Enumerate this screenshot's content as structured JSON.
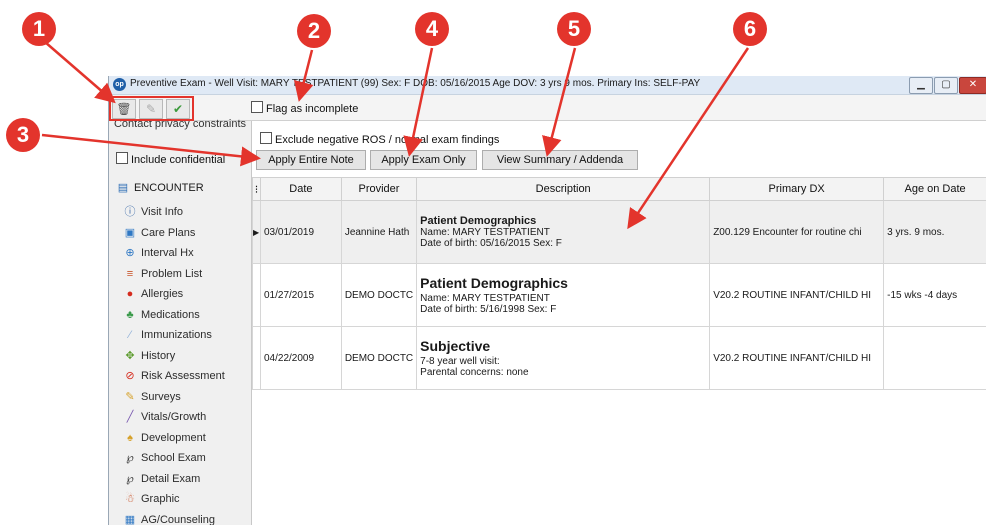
{
  "window": {
    "logo_text": "op",
    "title": "Preventive Exam - Well Visit: MARY TESTPATIENT (99)  Sex: F  DOB: 05/16/2015  Age DOV: 3 yrs 9 mos.  Primary Ins: SELF-PAY"
  },
  "toolbar": {
    "flag_label": "Flag as incomplete"
  },
  "sidebar": {
    "privacy_text": "Contact privacy constraints",
    "confidential_label": "Include confidential",
    "encounter_label": "ENCOUNTER",
    "items": [
      {
        "label": "Visit Info",
        "icon": "info-icon"
      },
      {
        "label": "Care Plans",
        "icon": "care-plan-icon"
      },
      {
        "label": "Interval Hx",
        "icon": "interval-hx-icon"
      },
      {
        "label": "Problem List",
        "icon": "problem-list-icon"
      },
      {
        "label": "Allergies",
        "icon": "allergy-icon"
      },
      {
        "label": "Medications",
        "icon": "medication-icon"
      },
      {
        "label": "Immunizations",
        "icon": "syringe-icon"
      },
      {
        "label": "History",
        "icon": "history-icon"
      },
      {
        "label": "Risk Assessment",
        "icon": "risk-icon"
      },
      {
        "label": "Surveys",
        "icon": "survey-icon"
      },
      {
        "label": "Vitals/Growth",
        "icon": "vitals-icon"
      },
      {
        "label": "Development",
        "icon": "development-icon"
      },
      {
        "label": "School Exam",
        "icon": "stethoscope-icon"
      },
      {
        "label": "Detail Exam",
        "icon": "stethoscope-icon"
      },
      {
        "label": "Graphic",
        "icon": "figure-icon"
      },
      {
        "label": "AG/Counseling",
        "icon": "counseling-icon"
      }
    ]
  },
  "content": {
    "exclude_label": "Exclude negative ROS / normal exam findings",
    "buttons": {
      "apply_entire": "Apply Entire Note",
      "apply_exam": "Apply Exam Only",
      "view_summary": "View Summary / Addenda"
    },
    "columns": [
      "Date",
      "Provider",
      "Description",
      "Primary DX",
      "Age on Date"
    ],
    "rows": [
      {
        "date": "03/01/2019",
        "provider": "Jeannine Hath",
        "desc_title": "Patient Demographics",
        "desc_line1": "Name: MARY TESTPATIENT",
        "desc_line2": "Date of birth: 05/16/2015   Sex: F",
        "dx": "Z00.129 Encounter for routine chi",
        "age": "3 yrs. 9 mos."
      },
      {
        "date": "01/27/2015",
        "provider": "DEMO DOCTC",
        "desc_title": "Patient Demographics",
        "desc_line1": "Name: MARY TESTPATIENT",
        "desc_line2": "Date of birth: 5/16/1998   Sex: F",
        "dx": "V20.2 ROUTINE INFANT/CHILD HI",
        "age": "-15 wks -4 days"
      },
      {
        "date": "04/22/2009",
        "provider": "DEMO DOCTC",
        "desc_title": "Subjective",
        "desc_line1": "7-8 year well visit:",
        "desc_line2": "Parental concerns: none",
        "dx": "V20.2 ROUTINE INFANT/CHILD HI",
        "age": ""
      }
    ]
  },
  "annotations": [
    "1",
    "2",
    "3",
    "4",
    "5",
    "6"
  ],
  "colors": {
    "marker": "#e3342c",
    "title_bar": "#dfe9f5"
  }
}
